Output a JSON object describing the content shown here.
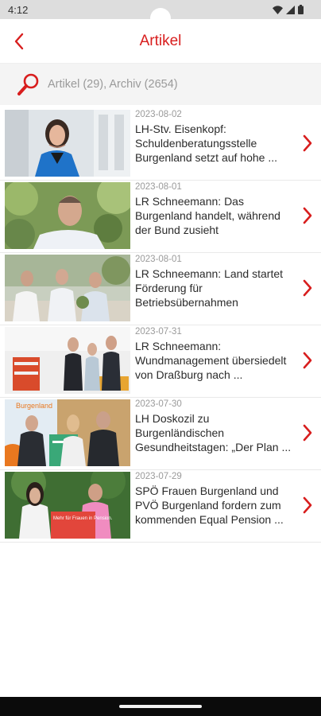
{
  "status_bar": {
    "time": "4:12",
    "icons": [
      "wifi-icon",
      "signal-icon",
      "battery-icon"
    ]
  },
  "header": {
    "title": "Artikel",
    "back_icon": "chevron-left-icon",
    "accent": "#d81e1e"
  },
  "search": {
    "icon": "magnifier-icon",
    "counts": "Artikel (29), Archiv (2654)"
  },
  "articles": [
    {
      "date": "2023-08-02",
      "title": "LH-Stv. Eisenkopf: Schuldenberatungsstelle Burgenland setzt auf hohe ..."
    },
    {
      "date": "2023-08-01",
      "title": "LR Schneemann: Das Burgenland handelt, während der Bund zusieht"
    },
    {
      "date": "2023-08-01",
      "title": "LR Schneemann: Land startet Förderung für Betriebsübernahmen"
    },
    {
      "date": "2023-07-31",
      "title": "LR Schneemann: Wundmanagement übersiedelt von Draßburg nach ..."
    },
    {
      "date": "2023-07-30",
      "title": "LH Doskozil zu Burgenländischen Gesundheitstagen: „Der Plan ..."
    },
    {
      "date": "2023-07-29",
      "title": "SPÖ Frauen Burgenland und PVÖ Burgenland fordern zum kommenden Equal Pension ..."
    }
  ],
  "thumb_texts": {
    "banner": "Burgenland",
    "sign": "Mehr für Frauen in Pension."
  }
}
